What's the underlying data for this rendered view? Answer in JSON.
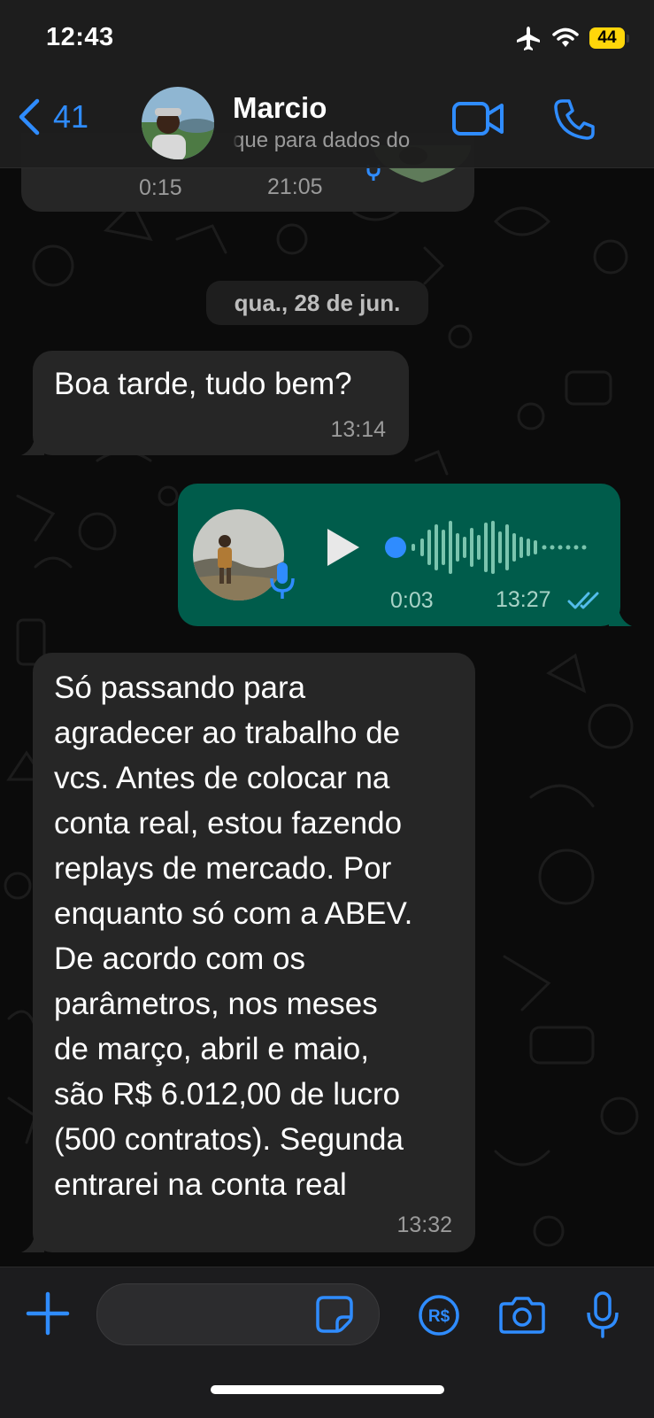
{
  "status_bar": {
    "time": "12:43",
    "battery_level": "44",
    "icons": [
      "airplane-icon",
      "wifi-icon",
      "battery-icon"
    ]
  },
  "header": {
    "back_count": "41",
    "contact_name": "Marcio",
    "contact_subtitle": "que para dados do",
    "icons": [
      "chevron-left-icon",
      "video-camera-icon",
      "phone-icon"
    ]
  },
  "previous_message": {
    "duration": "0:15",
    "time": "21:05"
  },
  "date_separator": "qua., 28 de jun.",
  "messages": [
    {
      "direction": "incoming",
      "text": "Boa tarde, tudo bem?",
      "time": "13:14"
    },
    {
      "direction": "outgoing",
      "type": "voice",
      "duration": "0:03",
      "time": "13:27",
      "status": "read"
    },
    {
      "direction": "incoming",
      "text": "Só passando para\nagradecer ao trabalho de\nvcs. Antes de colocar na\nconta real, estou fazendo\nreplays de mercado. Por\nenquanto só com a ABEV.\nDe acordo com os\nparâmetros, nos meses\nde março, abril e maio,\nsão R$ 6.012,00 de lucro\n(500 contratos). Segunda\nentrarei na conta real",
      "time": "13:32"
    }
  ],
  "input_bar": {
    "placeholder": "",
    "icons": [
      "plus-icon",
      "sticker-icon",
      "pix-icon",
      "camera-icon",
      "microphone-icon"
    ]
  },
  "colors": {
    "accent": "#2f8cff",
    "incoming_bubble": "#262626",
    "outgoing_bubble": "#005c4b",
    "battery": "#ffd60a"
  }
}
